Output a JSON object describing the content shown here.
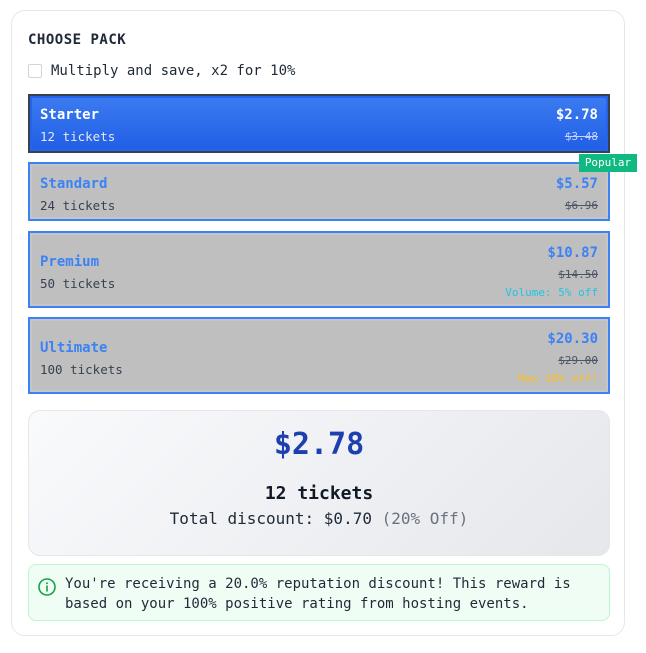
{
  "header": {
    "title": "CHOOSE PACK"
  },
  "multiply": {
    "label": "Multiply and save, x2 for 10%",
    "checked": false
  },
  "packs": [
    {
      "name": "Starter",
      "tickets": "12 tickets",
      "price": "$2.78",
      "old_price": "$3.48",
      "selected": true
    },
    {
      "name": "Standard",
      "tickets": "24 tickets",
      "price": "$5.57",
      "old_price": "$6.96",
      "badge": "Popular"
    },
    {
      "name": "Premium",
      "tickets": "50 tickets",
      "price": "$10.87",
      "old_price": "$14.50",
      "note": "Volume: 5% off"
    },
    {
      "name": "Ultimate",
      "tickets": "100 tickets",
      "price": "$20.30",
      "old_price": "$29.00",
      "note": "Max 30% off!"
    }
  ],
  "summary": {
    "price": "$2.78",
    "tickets": "12 tickets",
    "discount_label": "Total discount: $0.70",
    "discount_pct": "(20% Off)"
  },
  "notice": {
    "icon": "info-icon",
    "message": "You're receiving a 20.0% reputation discount! This reward is based on your 100% positive rating from hosting events."
  },
  "colors": {
    "selected_bg": "#2563eb",
    "accent_blue": "#3b82f6",
    "popular_badge": "#10b981",
    "volume_note": "#22c3e6",
    "max_note": "#fbbf24",
    "summary_price": "#1e40af"
  }
}
